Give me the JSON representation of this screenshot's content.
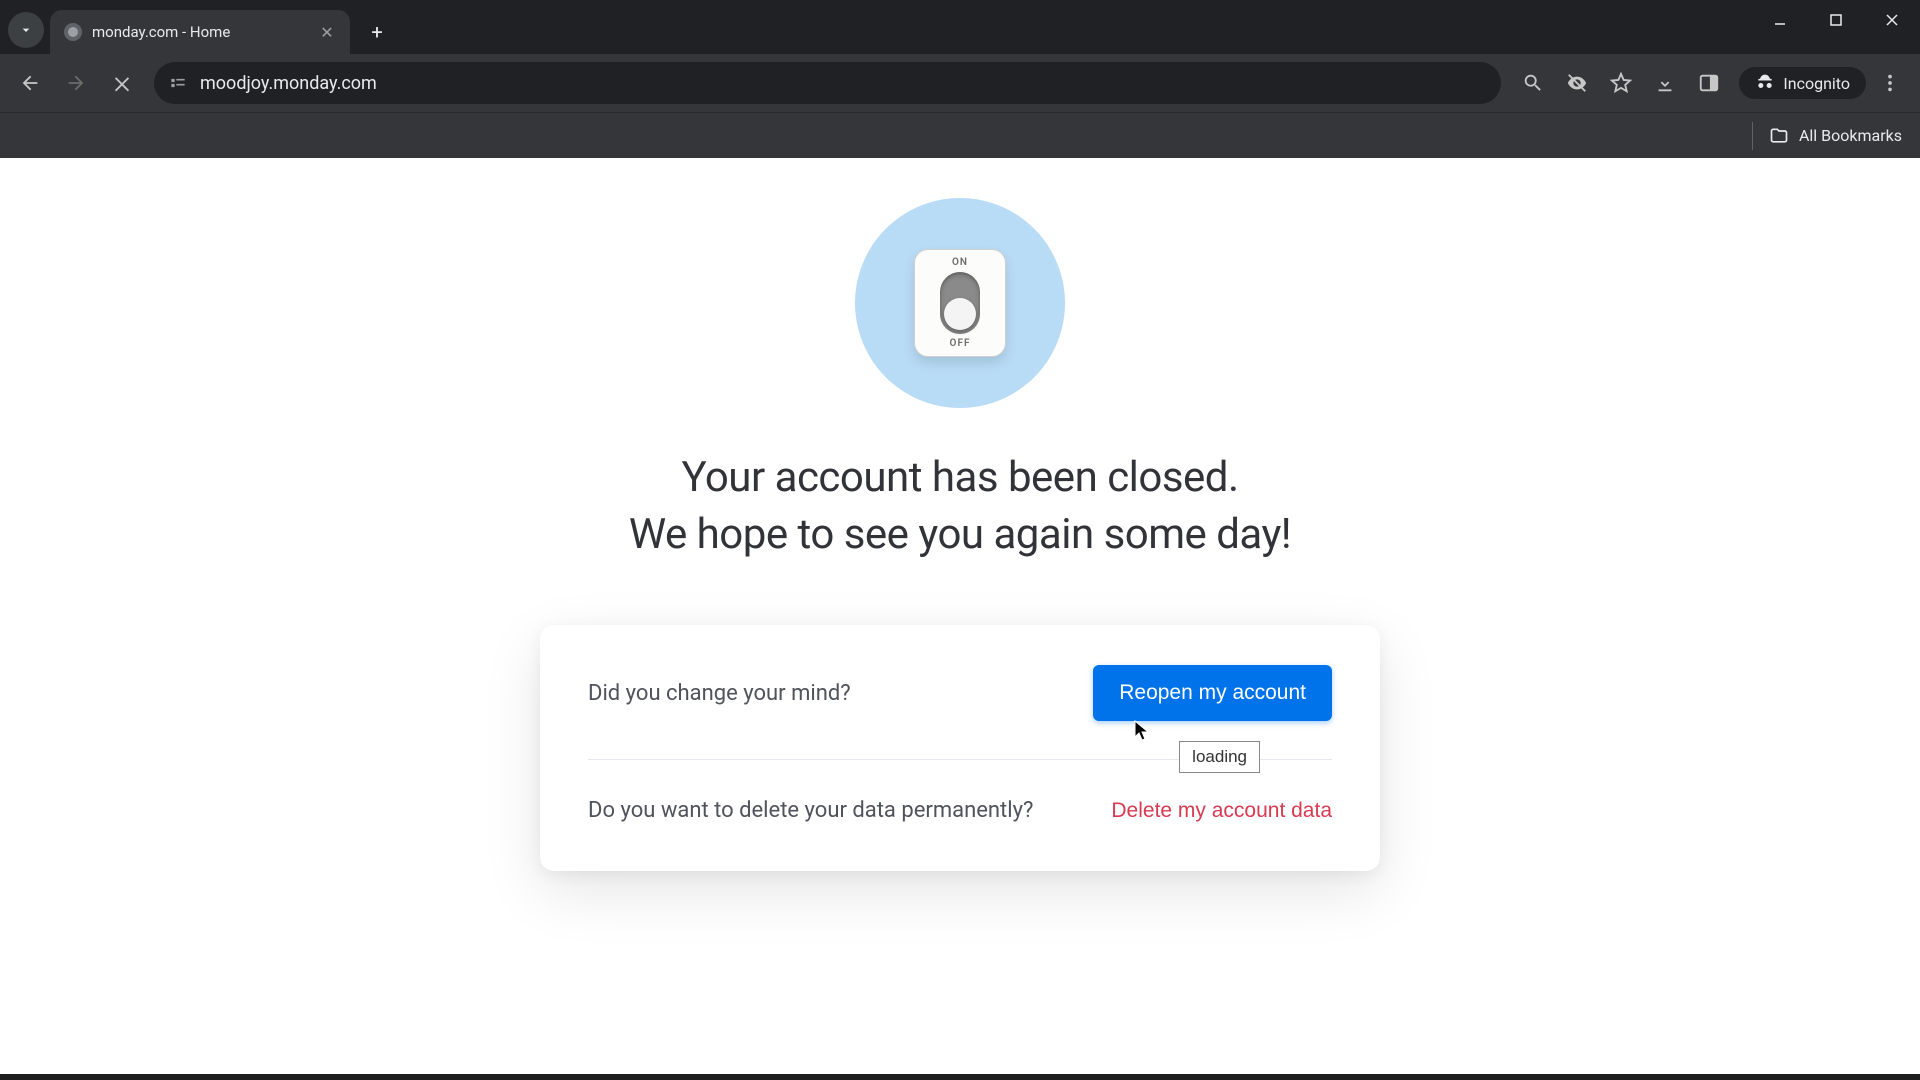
{
  "browser": {
    "tab_title": "monday.com - Home",
    "url": "moodjoy.monday.com",
    "incognito_label": "Incognito",
    "all_bookmarks_label": "All Bookmarks"
  },
  "hero": {
    "switch_on": "ON",
    "switch_off": "OFF"
  },
  "headline": {
    "line1": "Your account has been closed.",
    "line2": "We hope to see you again some day!"
  },
  "card": {
    "reopen_prompt": "Did you change your mind?",
    "reopen_button": "Reopen my account",
    "delete_prompt": "Do you want to delete your data permanently?",
    "delete_link": "Delete my account data",
    "tooltip": "loading"
  },
  "colors": {
    "primary": "#0073ea",
    "danger": "#d83a52",
    "hero_bg": "#b9dcf6"
  }
}
